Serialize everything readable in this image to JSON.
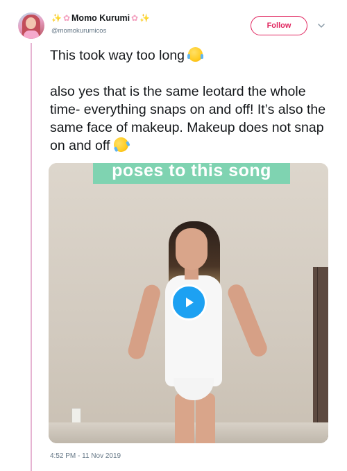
{
  "user": {
    "name": "Momo Kurumi",
    "handle": "@momokurumicos"
  },
  "follow_button": {
    "label": "Follow"
  },
  "tweet": {
    "line1": "This took way too long",
    "para2": "also yes that is the same leotard the whole time- everything snaps on and off! It’s also the same face of makeup. Makeup does not snap on and off",
    "emoji1": "face-with-tears-of-joy-icon",
    "emoji2": "rolling-on-floor-laughing-icon"
  },
  "media": {
    "caption": "poses to this song"
  },
  "timestamp": "4:52 PM - 11 Nov 2019",
  "colors": {
    "follow": "#e0245e",
    "play": "#1da1f2",
    "caption_bg": "#7fd3b1",
    "thread_line": "#e6b4d2"
  }
}
